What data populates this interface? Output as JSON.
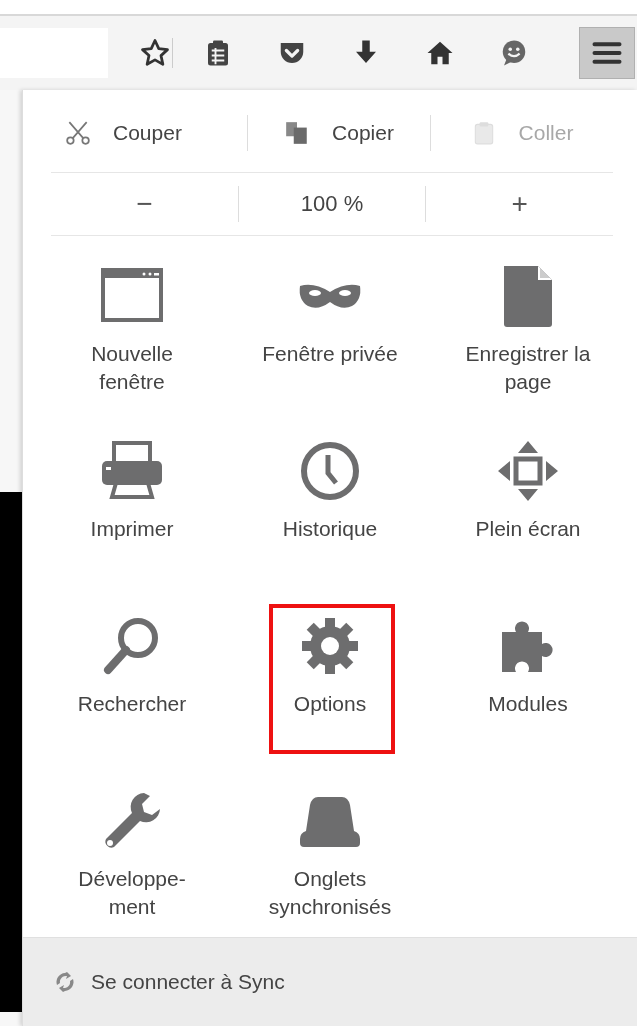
{
  "toolbar": {
    "menu_button": {
      "selected": true
    }
  },
  "edit_row": [
    {
      "label": "Couper",
      "disabled": false
    },
    {
      "label": "Copier",
      "disabled": false
    },
    {
      "label": "Coller",
      "disabled": true
    }
  ],
  "zoom_row": {
    "decrease": "−",
    "level": "100 %",
    "increase": "+"
  },
  "items": [
    {
      "label": "Nouvelle\nfenêtre",
      "highlighted": false
    },
    {
      "label": "Fenêtre privée",
      "highlighted": false
    },
    {
      "label": "Enregistrer la\npage",
      "highlighted": false
    },
    {
      "label": "Imprimer",
      "highlighted": false
    },
    {
      "label": "Historique",
      "highlighted": false
    },
    {
      "label": "Plein écran",
      "highlighted": false
    },
    {
      "label": "Rechercher",
      "highlighted": false
    },
    {
      "label": "Options",
      "highlighted": true
    },
    {
      "label": "Modules",
      "highlighted": false
    },
    {
      "label": "Développe-\nment",
      "highlighted": false
    },
    {
      "label": "Onglets\nsynchronisés",
      "highlighted": false
    }
  ],
  "footer": {
    "label": "Se connecter à Sync"
  }
}
